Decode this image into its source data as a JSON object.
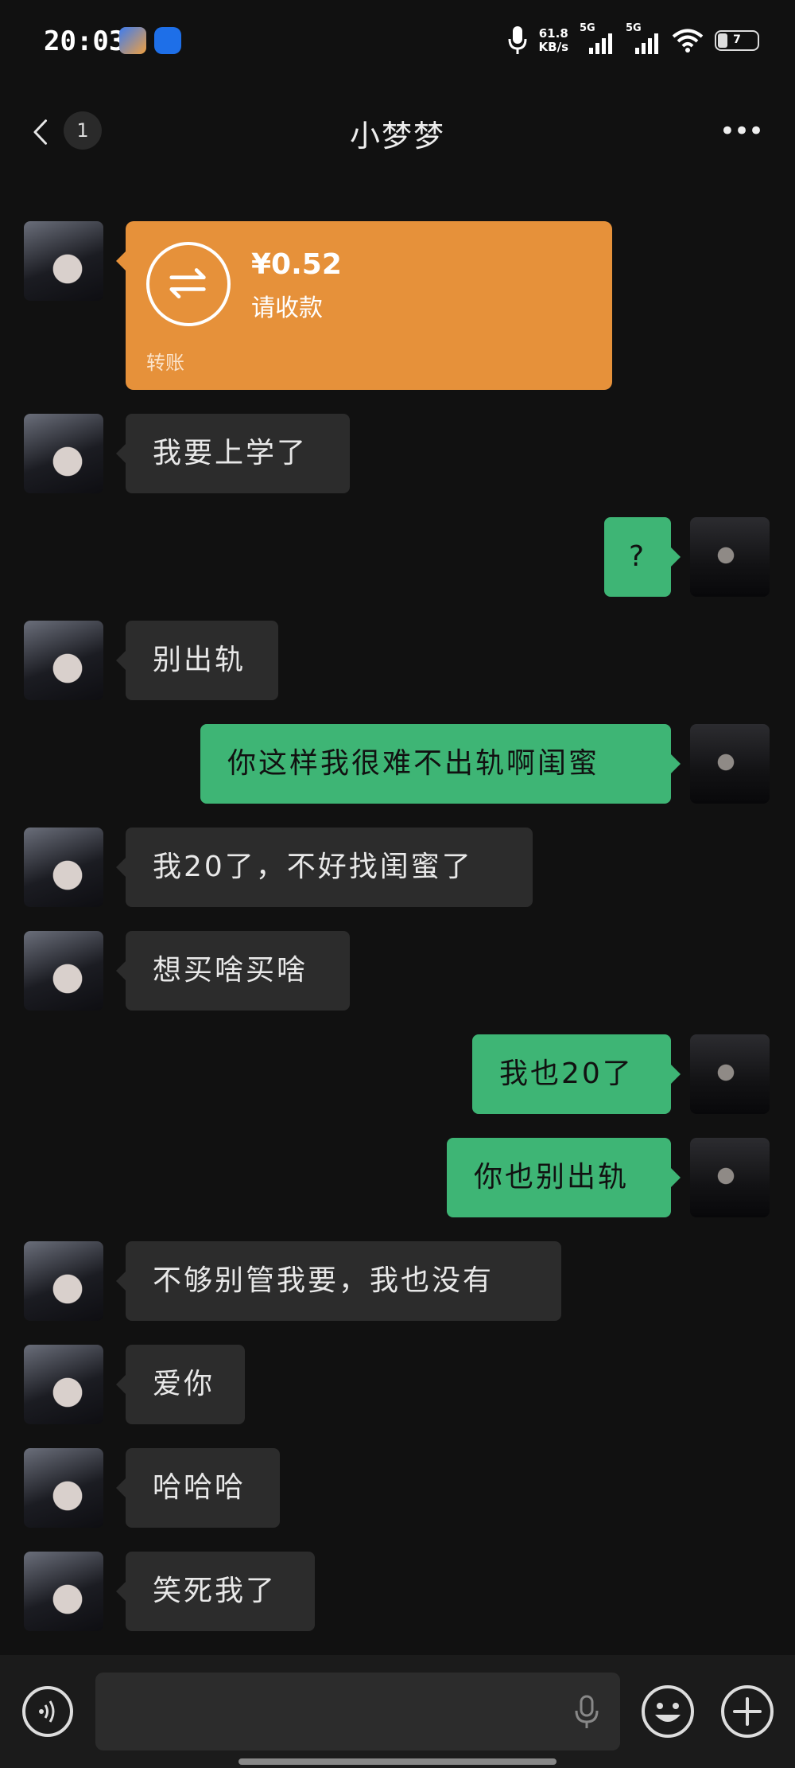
{
  "status_bar": {
    "time": "20:03",
    "net_speed_value": "61.8",
    "net_speed_unit": "KB/s",
    "signal_1": "5G",
    "signal_2": "5G",
    "battery": "7"
  },
  "header": {
    "back_icon": "chevron-left-icon",
    "unread_count": "1",
    "title": "小梦梦",
    "more_icon": "more-dots-icon",
    "more_label": "•••"
  },
  "transfer": {
    "amount": "¥0.52",
    "status": "请收款",
    "label": "转账",
    "color": "#e6913a"
  },
  "messages": [
    {
      "side": "in",
      "text": "我要上学了"
    },
    {
      "side": "out",
      "text": "?"
    },
    {
      "side": "in",
      "text": "别出轨"
    },
    {
      "side": "out",
      "text": "你这样我很难不出轨啊闺蜜"
    },
    {
      "side": "in",
      "text": "我20了，不好找闺蜜了"
    },
    {
      "side": "in",
      "text": "想买啥买啥"
    },
    {
      "side": "out",
      "text": "我也20了"
    },
    {
      "side": "out",
      "text": "你也别出轨"
    },
    {
      "side": "in",
      "text": "不够别管我要，我也没有"
    },
    {
      "side": "in",
      "text": "爱你"
    },
    {
      "side": "in",
      "text": "哈哈哈"
    },
    {
      "side": "in",
      "text": "笑死我了"
    }
  ],
  "input_bar": {
    "voice_icon": "voice-toggle-icon",
    "mic_icon": "microphone-icon",
    "emoji_icon": "emoji-icon",
    "plus_icon": "plus-icon"
  },
  "colors": {
    "background": "#111111",
    "incoming_bubble": "#2c2c2c",
    "outgoing_bubble": "#3eb575"
  }
}
